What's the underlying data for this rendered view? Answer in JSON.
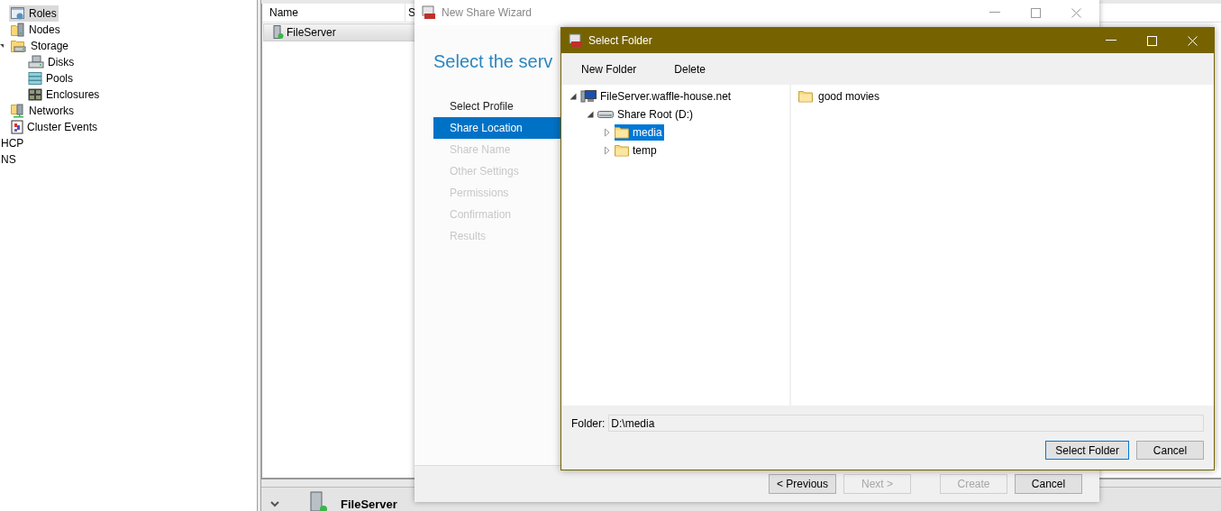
{
  "console": {
    "tree": [
      {
        "label": "Roles",
        "kind": "roles",
        "selected": true
      },
      {
        "label": "Nodes",
        "kind": "nodes",
        "selected": false
      },
      {
        "label": "Storage",
        "kind": "storage",
        "selected": false,
        "expanded": true,
        "children": [
          {
            "label": "Disks",
            "kind": "disks",
            "selected": false
          },
          {
            "label": "Pools",
            "kind": "pools",
            "selected": false
          },
          {
            "label": "Enclosures",
            "kind": "enclosures",
            "selected": false
          }
        ]
      },
      {
        "label": "Networks",
        "kind": "networks",
        "selected": false
      },
      {
        "label": "Cluster Events",
        "kind": "events",
        "selected": false
      }
    ],
    "other_nodes": [
      "HCP",
      "NS"
    ],
    "columns": [
      "Name",
      "S"
    ],
    "rows": [
      {
        "name": "FileServer",
        "selected": true
      }
    ],
    "details_title": "FileServer"
  },
  "wizard": {
    "title": "New Share Wizard",
    "heading": "Select the serv",
    "steps": [
      {
        "label": "Select Profile",
        "selected": false,
        "disabled": false
      },
      {
        "label": "Share Location",
        "selected": true,
        "disabled": false
      },
      {
        "label": "Share Name",
        "selected": false,
        "disabled": true
      },
      {
        "label": "Other Settings",
        "selected": false,
        "disabled": true
      },
      {
        "label": "Permissions",
        "selected": false,
        "disabled": true
      },
      {
        "label": "Confirmation",
        "selected": false,
        "disabled": true
      },
      {
        "label": "Results",
        "selected": false,
        "disabled": true
      }
    ],
    "buttons": [
      {
        "label": "< Previous",
        "disabled": false
      },
      {
        "label": "Next >",
        "disabled": true
      },
      {
        "label": "Create",
        "disabled": true
      },
      {
        "label": "Cancel",
        "disabled": false
      }
    ]
  },
  "dialog": {
    "title": "Select Folder",
    "toolbar": [
      "New Folder",
      "Delete"
    ],
    "tree": [
      {
        "label": "FileServer.waffle-house.net",
        "kind": "computer",
        "expanded": true,
        "selected": false,
        "children": [
          {
            "label": "Share Root (D:)",
            "kind": "drive",
            "expanded": true,
            "selected": false,
            "children": [
              {
                "label": "media",
                "kind": "folder",
                "expanded": false,
                "selected": true
              },
              {
                "label": "temp",
                "kind": "folder",
                "expanded": false,
                "selected": false
              }
            ]
          }
        ]
      }
    ],
    "contents": [
      {
        "name": "good movies"
      }
    ],
    "folder_label": "Folder:",
    "folder_value": "D:\\media",
    "buttons": [
      {
        "label": "Select Folder",
        "default": true
      },
      {
        "label": "Cancel",
        "default": false
      }
    ]
  }
}
